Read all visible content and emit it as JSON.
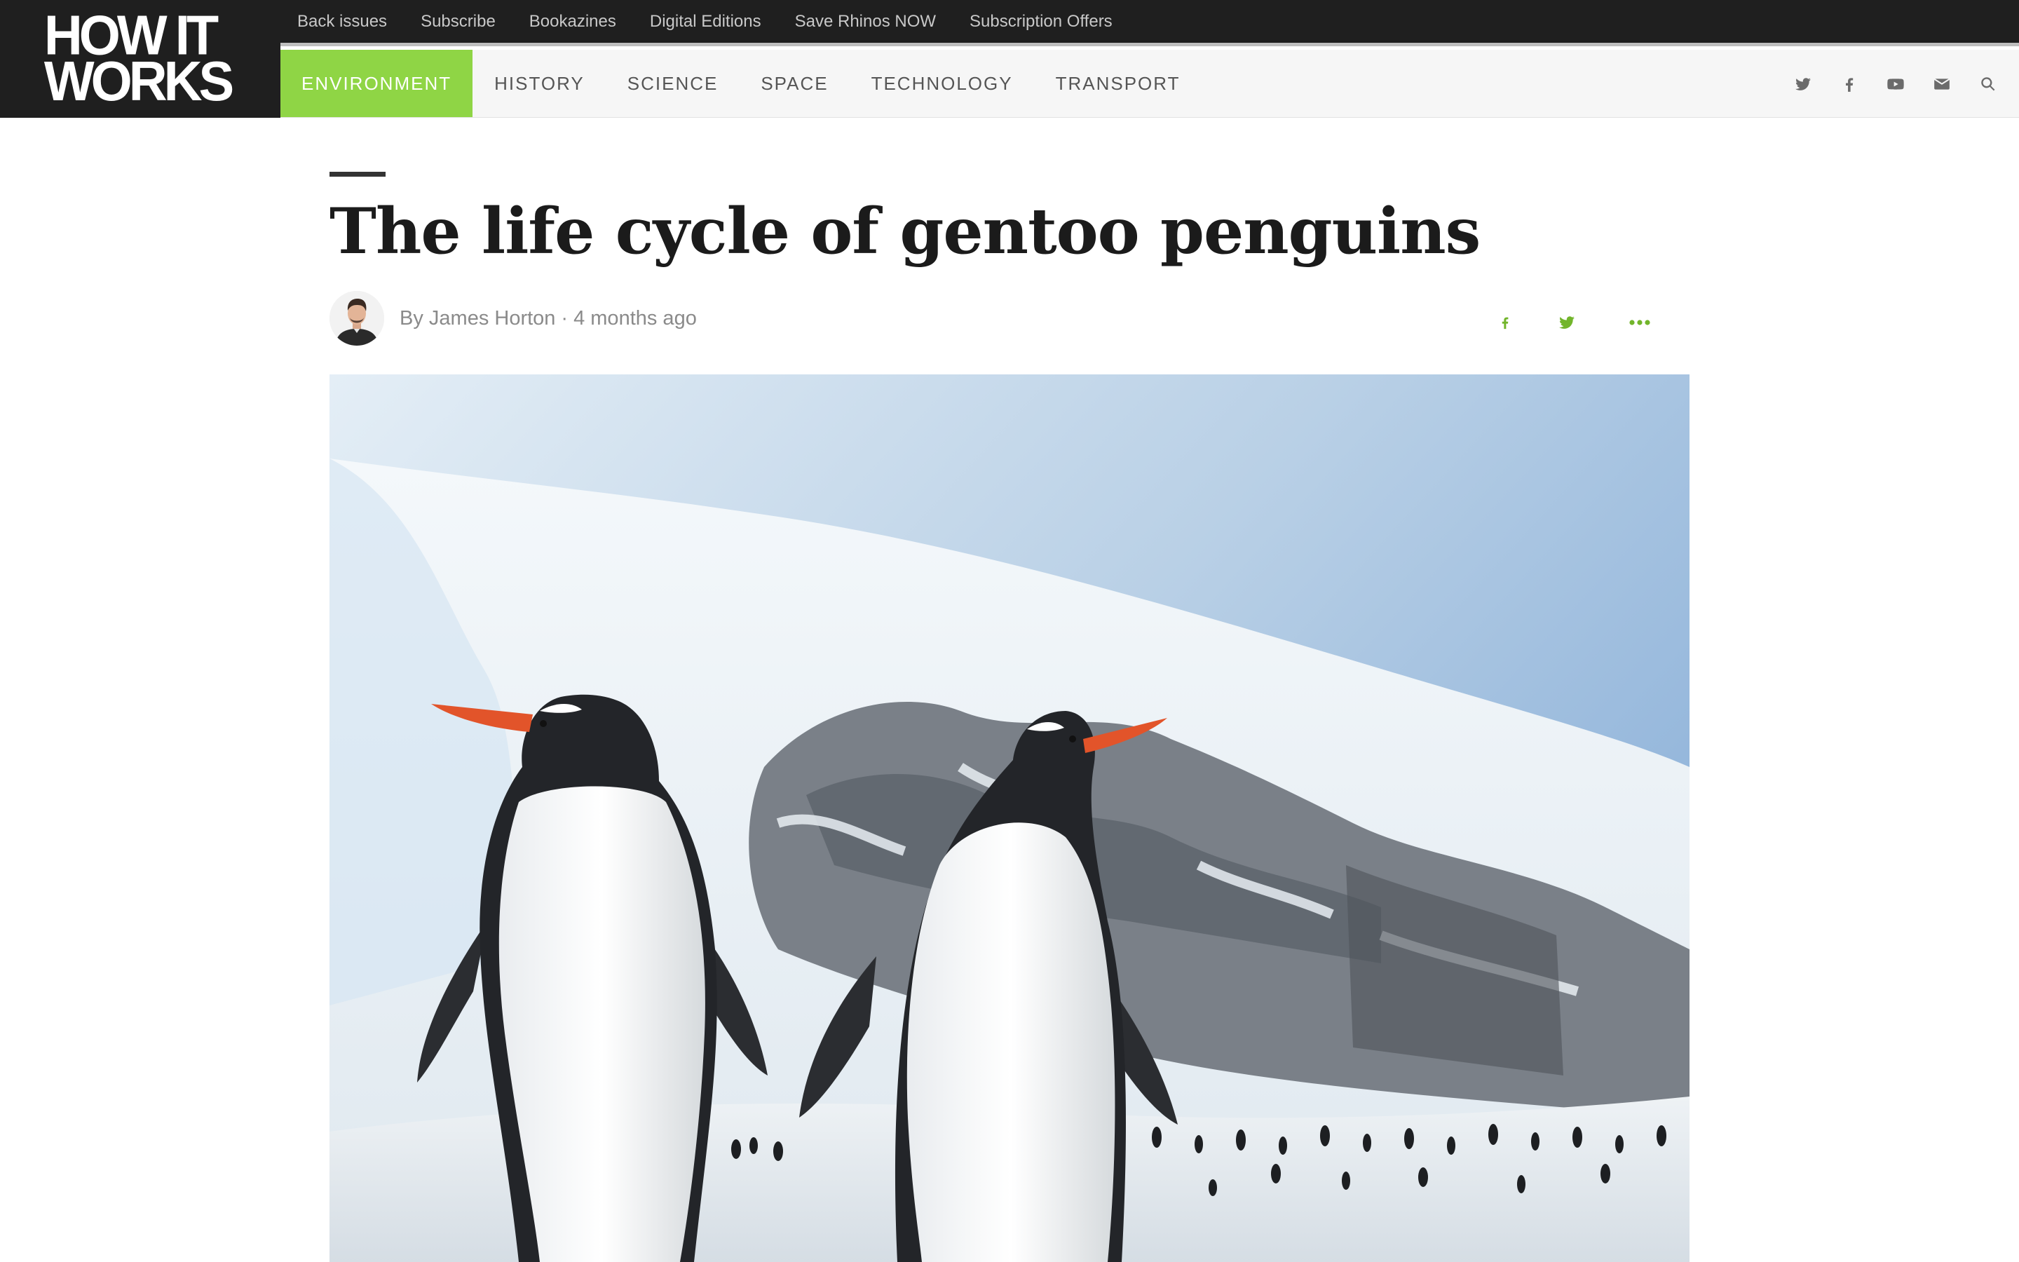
{
  "brand": {
    "logo_line1": "HOW IT",
    "logo_line2": "WORKS"
  },
  "top_nav": [
    "Back issues",
    "Subscribe",
    "Bookazines",
    "Digital Editions",
    "Save Rhinos NOW",
    "Subscription Offers"
  ],
  "categories": [
    "ENVIRONMENT",
    "HISTORY",
    "SCIENCE",
    "SPACE",
    "TECHNOLOGY",
    "TRANSPORT"
  ],
  "active_category": "ENVIRONMENT",
  "social_icons": [
    "twitter-icon",
    "facebook-icon",
    "youtube-icon",
    "email-icon",
    "search-icon"
  ],
  "article": {
    "title": "The life cycle of gentoo penguins",
    "byline_prefix": "By",
    "author": "James Horton",
    "separator": "·",
    "time_ago": "4 months ago"
  },
  "share_icons": [
    "facebook-icon",
    "twitter-icon",
    "more-icon"
  ],
  "colors": {
    "accent_green": "#8fd545",
    "share_green": "#72b52b",
    "header_dark": "#1f1f1f"
  },
  "hero_image": {
    "subject": "photo-of-gentoo-penguins"
  }
}
